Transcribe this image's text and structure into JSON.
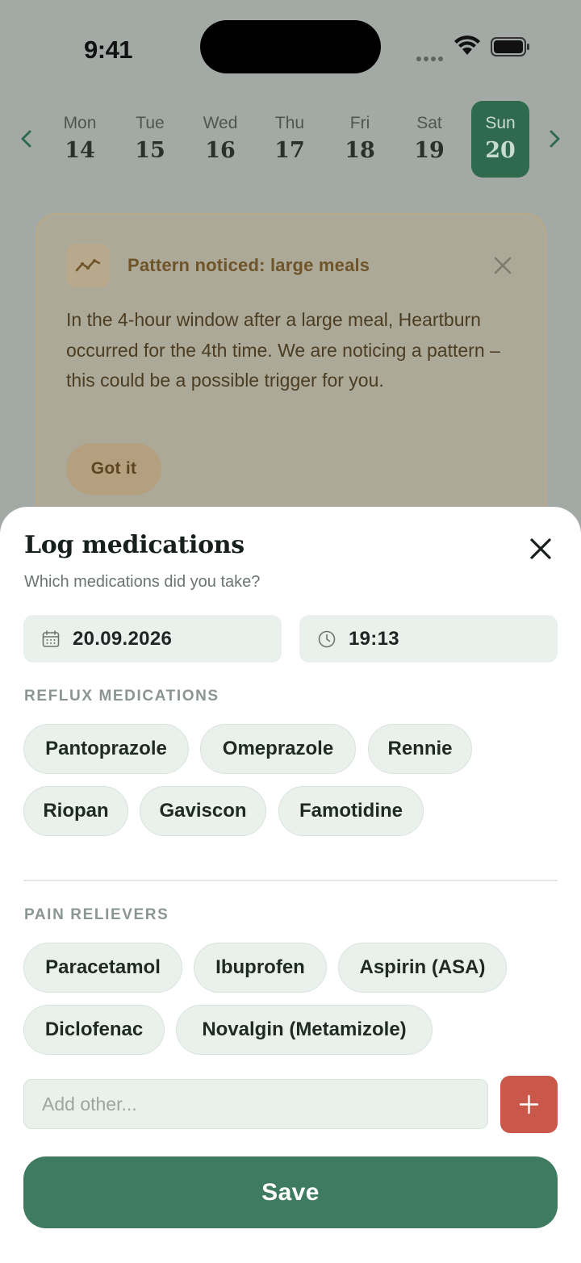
{
  "status_bar": {
    "time": "9:41"
  },
  "week": {
    "days": [
      {
        "name": "Mon",
        "num": "14"
      },
      {
        "name": "Tue",
        "num": "15"
      },
      {
        "name": "Wed",
        "num": "16"
      },
      {
        "name": "Thu",
        "num": "17"
      },
      {
        "name": "Fri",
        "num": "18"
      },
      {
        "name": "Sat",
        "num": "19"
      },
      {
        "name": "Sun",
        "num": "20"
      }
    ],
    "selected_day": "Sun 20"
  },
  "insight": {
    "title": "Pattern noticed: large meals",
    "body": "In the 4-hour window after a large meal, Heartburn occurred for the 4th time. We are noticing a pattern – this could be a possible trigger for you.",
    "button": "Got it"
  },
  "sheet": {
    "title": "Log medications",
    "subtitle": "Which medications did you take?",
    "date": "20.09.2026",
    "time": "19:13",
    "reflux_label": "REFLUX MEDICATIONS",
    "reflux": [
      "Pantoprazole",
      "Omeprazole",
      "Rennie",
      "Riopan",
      "Gaviscon",
      "Famotidine"
    ],
    "pain_label": "PAIN RELIEVERS",
    "pain": [
      "Paracetamol",
      "Ibuprofen",
      "Aspirin (ASA)",
      "Diclofenac",
      "Novalgin (Metamizole)"
    ],
    "add_placeholder": "Add other...",
    "save": "Save"
  },
  "colors": {
    "accent": "#3f7b61",
    "selected_day": "#2f6a4e",
    "add_button": "#c9584a",
    "chip_bg": "#eaf1ec",
    "insight_title": "#6e5428"
  }
}
